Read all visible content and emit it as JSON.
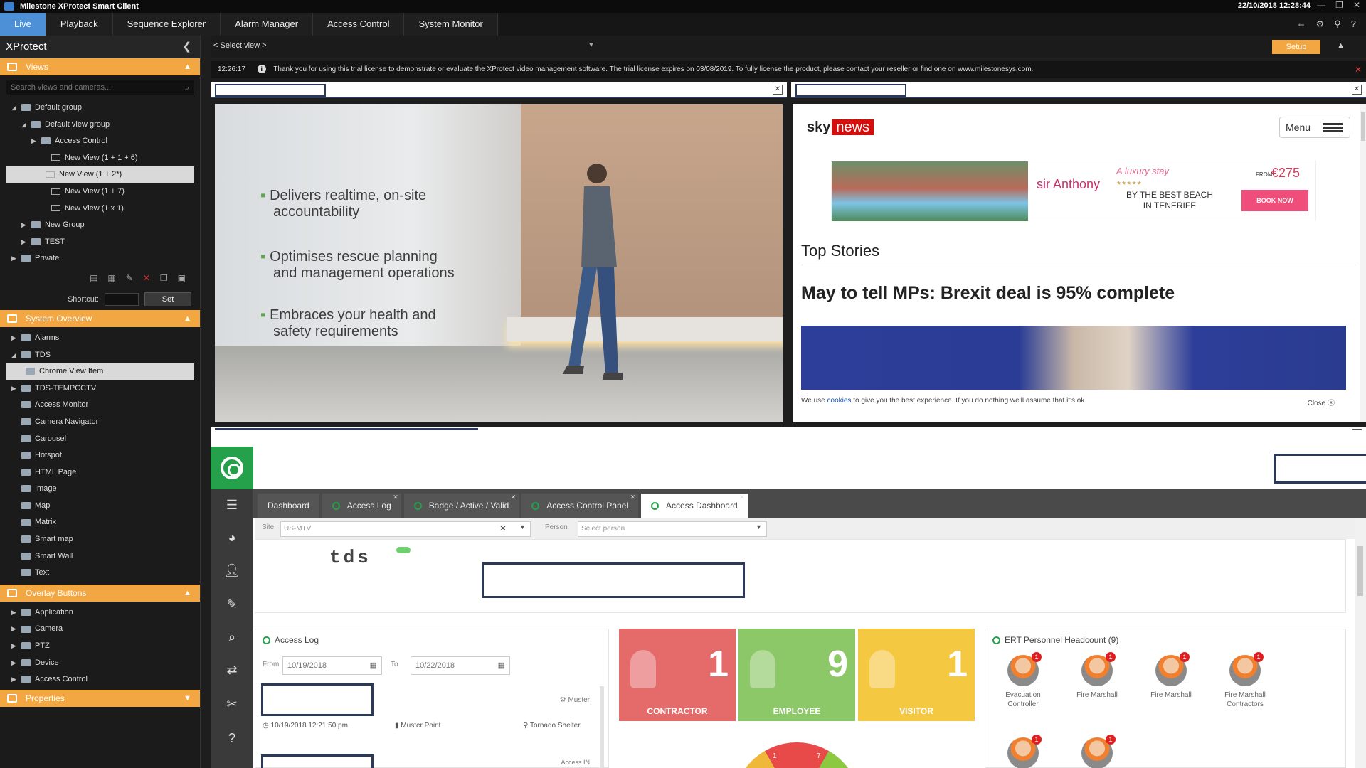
{
  "window": {
    "title": "Milestone XProtect Smart Client",
    "datetime": "22/10/2018 12:28:44",
    "minimize_glyph": "—",
    "restore_glyph": "❐",
    "close_glyph": "✕"
  },
  "main_tabs": [
    "Live",
    "Playback",
    "Sequence Explorer",
    "Alarm Manager",
    "Access Control",
    "System Monitor"
  ],
  "toolbar_icons": [
    "back-forward-icon",
    "settings-icon",
    "pin-icon",
    "help-icon"
  ],
  "sidebar": {
    "title": "XProtect",
    "views_panel": "Views",
    "search_placeholder": "Search views and cameras...",
    "tree": [
      {
        "label": "Default group",
        "level": 0,
        "kind": "folder",
        "arrow": "◢"
      },
      {
        "label": "Default view group",
        "level": 1,
        "kind": "folder",
        "arrow": "◢"
      },
      {
        "label": "Access Control",
        "level": 2,
        "kind": "folder",
        "arrow": "▶"
      },
      {
        "label": "New View (1 + 1 + 6)",
        "level": 3,
        "kind": "view"
      },
      {
        "label": "New View (1 + 2*)",
        "level": 3,
        "kind": "view",
        "selected": true
      },
      {
        "label": "New View (1 + 7)",
        "level": 3,
        "kind": "view"
      },
      {
        "label": "New View (1 x 1)",
        "level": 3,
        "kind": "view"
      },
      {
        "label": "New Group",
        "level": 1,
        "kind": "folder",
        "arrow": "▶"
      },
      {
        "label": "TEST",
        "level": 1,
        "kind": "folder",
        "arrow": "▶"
      },
      {
        "label": "Private",
        "level": 0,
        "kind": "folder",
        "arrow": "▶"
      }
    ],
    "shortcut_label": "Shortcut:",
    "set_button": "Set",
    "system_overview_panel": "System Overview",
    "system_tree": [
      {
        "label": "Alarms",
        "level": 0,
        "arrow": "▶"
      },
      {
        "label": "TDS",
        "level": 0,
        "arrow": "◢"
      },
      {
        "label": "Chrome View Item",
        "level": 1,
        "selected": true
      },
      {
        "label": "TDS-TEMPCCTV",
        "level": 0,
        "arrow": "▶"
      },
      {
        "label": "Access Monitor",
        "level": 0
      },
      {
        "label": "Camera Navigator",
        "level": 0
      },
      {
        "label": "Carousel",
        "level": 0
      },
      {
        "label": "Hotspot",
        "level": 0
      },
      {
        "label": "HTML Page",
        "level": 0
      },
      {
        "label": "Image",
        "level": 0
      },
      {
        "label": "Map",
        "level": 0
      },
      {
        "label": "Matrix",
        "level": 0
      },
      {
        "label": "Smart map",
        "level": 0
      },
      {
        "label": "Smart Wall",
        "level": 0
      },
      {
        "label": "Text",
        "level": 0
      }
    ],
    "overlay_panel": "Overlay Buttons",
    "overlay_tree": [
      {
        "label": "Application",
        "arrow": "▶"
      },
      {
        "label": "Camera",
        "arrow": "▶"
      },
      {
        "label": "PTZ",
        "arrow": "▶"
      },
      {
        "label": "Device",
        "arrow": "▶"
      },
      {
        "label": "Access Control",
        "arrow": "▶"
      }
    ],
    "properties_panel": "Properties"
  },
  "viewbar": {
    "select_view": "< Select view >",
    "setup": "Setup"
  },
  "notice": {
    "time": "12:26:17",
    "text": "Thank you for using this trial license to demonstrate or evaluate the XProtect video management software. The trial license expires on 03/08/2019. To fully license the product, please contact your reseller or find one on www.milestonesys.com."
  },
  "video": {
    "bullets": [
      [
        "Delivers realtime, on-site",
        "accountability"
      ],
      [
        "Optimises rescue planning",
        "and management operations"
      ],
      [
        "Embraces your health and",
        "safety requirements"
      ]
    ]
  },
  "skynews": {
    "logo_a": "sky",
    "logo_b": "news",
    "menu": "Menu",
    "ad": {
      "brand": "sir Anthony",
      "tagline": "A luxury stay",
      "stars": "★★★★★",
      "line1": "BY THE BEST BEACH",
      "line2": "IN TENERIFE",
      "from": "FROM",
      "price": "€275",
      "book": "BOOK NOW"
    },
    "top_stories": "Top Stories",
    "headline": "May to tell MPs: Brexit deal is 95% complete",
    "cookie_pre": "We use",
    "cookie_link": "cookies",
    "cookie_post": "to give you the best experience. If you do nothing we'll assume that it's ok.",
    "close": "Close"
  },
  "access_app": {
    "tabs": [
      {
        "label": "Dashboard",
        "icon": false
      },
      {
        "label": "Access Log",
        "icon": true
      },
      {
        "label": "Badge / Active / Valid",
        "icon": true
      },
      {
        "label": "Access Control Panel",
        "icon": true
      },
      {
        "label": "Access Dashboard",
        "icon": true,
        "active": true
      }
    ],
    "site_label": "Site",
    "site_value": "US-MTV",
    "person_label": "Person",
    "person_placeholder": "Select person",
    "logo": "tds",
    "access_log": {
      "title": "Access Log",
      "from_label": "From",
      "from_value": "10/19/2018",
      "to_label": "To",
      "to_value": "10/22/2018",
      "muster": "Muster",
      "timestamp": "10/19/2018 12:21:50 pm",
      "muster_point": "Muster Point",
      "location": "Tornado Shelter",
      "access_in": "Access IN"
    },
    "cards": [
      {
        "label": "CONTRACTOR",
        "value": "1",
        "color": "#e56b6b"
      },
      {
        "label": "EMPLOYEE",
        "value": "9",
        "color": "#8cc868"
      },
      {
        "label": "VISITOR",
        "value": "1",
        "color": "#f5c842"
      }
    ],
    "gauge_labels": [
      "1",
      "7"
    ],
    "ert": {
      "title": "ERT Personnel Headcount (9)",
      "roles": [
        {
          "line1": "Evacuation",
          "line2": "Controller",
          "badge": "1"
        },
        {
          "line1": "Fire Marshall",
          "line2": "",
          "badge": "1"
        },
        {
          "line1": "Fire Marshall",
          "line2": "",
          "badge": "1"
        },
        {
          "line1": "Fire Marshall",
          "line2": "Contractors",
          "badge": "1"
        },
        {
          "line1": "",
          "line2": "",
          "badge": "1"
        },
        {
          "line1": "",
          "line2": "",
          "badge": "1"
        }
      ]
    }
  },
  "colors": {
    "accent_orange": "#f2a742",
    "live_tab_blue": "#4d90d8",
    "tds_green": "#24a14a"
  }
}
